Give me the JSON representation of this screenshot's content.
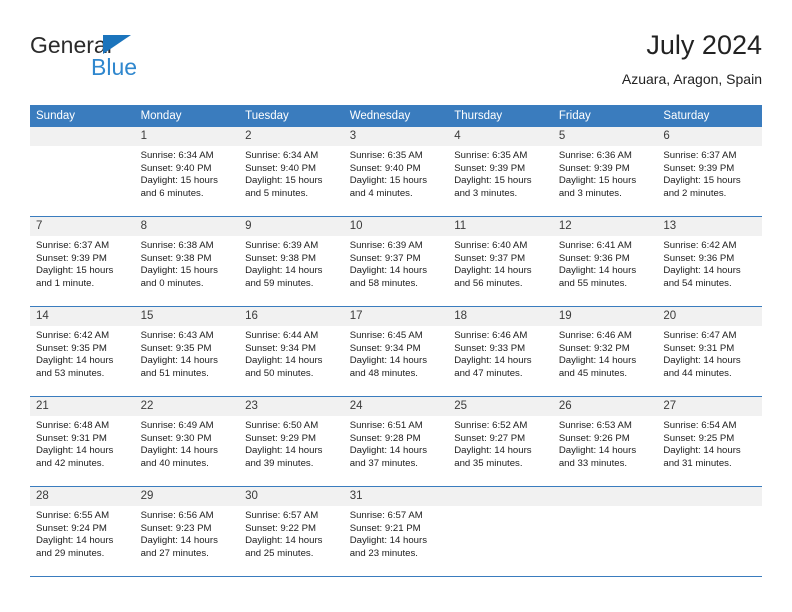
{
  "brand": {
    "word1": "General",
    "word2": "Blue",
    "triangle_color": "#1b74bc",
    "blue_color": "#2f87ce"
  },
  "header": {
    "title": "July 2024",
    "subtitle": "Azuara, Aragon, Spain",
    "band_color": "#3a7cbe"
  },
  "calendar": {
    "weekdays": [
      "Sunday",
      "Monday",
      "Tuesday",
      "Wednesday",
      "Thursday",
      "Friday",
      "Saturday"
    ],
    "weeks": [
      [
        {
          "day": "",
          "lines": []
        },
        {
          "day": "1",
          "lines": [
            "Sunrise: 6:34 AM",
            "Sunset: 9:40 PM",
            "Daylight: 15 hours",
            "and 6 minutes."
          ]
        },
        {
          "day": "2",
          "lines": [
            "Sunrise: 6:34 AM",
            "Sunset: 9:40 PM",
            "Daylight: 15 hours",
            "and 5 minutes."
          ]
        },
        {
          "day": "3",
          "lines": [
            "Sunrise: 6:35 AM",
            "Sunset: 9:40 PM",
            "Daylight: 15 hours",
            "and 4 minutes."
          ]
        },
        {
          "day": "4",
          "lines": [
            "Sunrise: 6:35 AM",
            "Sunset: 9:39 PM",
            "Daylight: 15 hours",
            "and 3 minutes."
          ]
        },
        {
          "day": "5",
          "lines": [
            "Sunrise: 6:36 AM",
            "Sunset: 9:39 PM",
            "Daylight: 15 hours",
            "and 3 minutes."
          ]
        },
        {
          "day": "6",
          "lines": [
            "Sunrise: 6:37 AM",
            "Sunset: 9:39 PM",
            "Daylight: 15 hours",
            "and 2 minutes."
          ]
        }
      ],
      [
        {
          "day": "7",
          "lines": [
            "Sunrise: 6:37 AM",
            "Sunset: 9:39 PM",
            "Daylight: 15 hours",
            "and 1 minute."
          ]
        },
        {
          "day": "8",
          "lines": [
            "Sunrise: 6:38 AM",
            "Sunset: 9:38 PM",
            "Daylight: 15 hours",
            "and 0 minutes."
          ]
        },
        {
          "day": "9",
          "lines": [
            "Sunrise: 6:39 AM",
            "Sunset: 9:38 PM",
            "Daylight: 14 hours",
            "and 59 minutes."
          ]
        },
        {
          "day": "10",
          "lines": [
            "Sunrise: 6:39 AM",
            "Sunset: 9:37 PM",
            "Daylight: 14 hours",
            "and 58 minutes."
          ]
        },
        {
          "day": "11",
          "lines": [
            "Sunrise: 6:40 AM",
            "Sunset: 9:37 PM",
            "Daylight: 14 hours",
            "and 56 minutes."
          ]
        },
        {
          "day": "12",
          "lines": [
            "Sunrise: 6:41 AM",
            "Sunset: 9:36 PM",
            "Daylight: 14 hours",
            "and 55 minutes."
          ]
        },
        {
          "day": "13",
          "lines": [
            "Sunrise: 6:42 AM",
            "Sunset: 9:36 PM",
            "Daylight: 14 hours",
            "and 54 minutes."
          ]
        }
      ],
      [
        {
          "day": "14",
          "lines": [
            "Sunrise: 6:42 AM",
            "Sunset: 9:35 PM",
            "Daylight: 14 hours",
            "and 53 minutes."
          ]
        },
        {
          "day": "15",
          "lines": [
            "Sunrise: 6:43 AM",
            "Sunset: 9:35 PM",
            "Daylight: 14 hours",
            "and 51 minutes."
          ]
        },
        {
          "day": "16",
          "lines": [
            "Sunrise: 6:44 AM",
            "Sunset: 9:34 PM",
            "Daylight: 14 hours",
            "and 50 minutes."
          ]
        },
        {
          "day": "17",
          "lines": [
            "Sunrise: 6:45 AM",
            "Sunset: 9:34 PM",
            "Daylight: 14 hours",
            "and 48 minutes."
          ]
        },
        {
          "day": "18",
          "lines": [
            "Sunrise: 6:46 AM",
            "Sunset: 9:33 PM",
            "Daylight: 14 hours",
            "and 47 minutes."
          ]
        },
        {
          "day": "19",
          "lines": [
            "Sunrise: 6:46 AM",
            "Sunset: 9:32 PM",
            "Daylight: 14 hours",
            "and 45 minutes."
          ]
        },
        {
          "day": "20",
          "lines": [
            "Sunrise: 6:47 AM",
            "Sunset: 9:31 PM",
            "Daylight: 14 hours",
            "and 44 minutes."
          ]
        }
      ],
      [
        {
          "day": "21",
          "lines": [
            "Sunrise: 6:48 AM",
            "Sunset: 9:31 PM",
            "Daylight: 14 hours",
            "and 42 minutes."
          ]
        },
        {
          "day": "22",
          "lines": [
            "Sunrise: 6:49 AM",
            "Sunset: 9:30 PM",
            "Daylight: 14 hours",
            "and 40 minutes."
          ]
        },
        {
          "day": "23",
          "lines": [
            "Sunrise: 6:50 AM",
            "Sunset: 9:29 PM",
            "Daylight: 14 hours",
            "and 39 minutes."
          ]
        },
        {
          "day": "24",
          "lines": [
            "Sunrise: 6:51 AM",
            "Sunset: 9:28 PM",
            "Daylight: 14 hours",
            "and 37 minutes."
          ]
        },
        {
          "day": "25",
          "lines": [
            "Sunrise: 6:52 AM",
            "Sunset: 9:27 PM",
            "Daylight: 14 hours",
            "and 35 minutes."
          ]
        },
        {
          "day": "26",
          "lines": [
            "Sunrise: 6:53 AM",
            "Sunset: 9:26 PM",
            "Daylight: 14 hours",
            "and 33 minutes."
          ]
        },
        {
          "day": "27",
          "lines": [
            "Sunrise: 6:54 AM",
            "Sunset: 9:25 PM",
            "Daylight: 14 hours",
            "and 31 minutes."
          ]
        }
      ],
      [
        {
          "day": "28",
          "lines": [
            "Sunrise: 6:55 AM",
            "Sunset: 9:24 PM",
            "Daylight: 14 hours",
            "and 29 minutes."
          ]
        },
        {
          "day": "29",
          "lines": [
            "Sunrise: 6:56 AM",
            "Sunset: 9:23 PM",
            "Daylight: 14 hours",
            "and 27 minutes."
          ]
        },
        {
          "day": "30",
          "lines": [
            "Sunrise: 6:57 AM",
            "Sunset: 9:22 PM",
            "Daylight: 14 hours",
            "and 25 minutes."
          ]
        },
        {
          "day": "31",
          "lines": [
            "Sunrise: 6:57 AM",
            "Sunset: 9:21 PM",
            "Daylight: 14 hours",
            "and 23 minutes."
          ]
        },
        {
          "day": "",
          "lines": []
        },
        {
          "day": "",
          "lines": []
        },
        {
          "day": "",
          "lines": []
        }
      ]
    ]
  }
}
